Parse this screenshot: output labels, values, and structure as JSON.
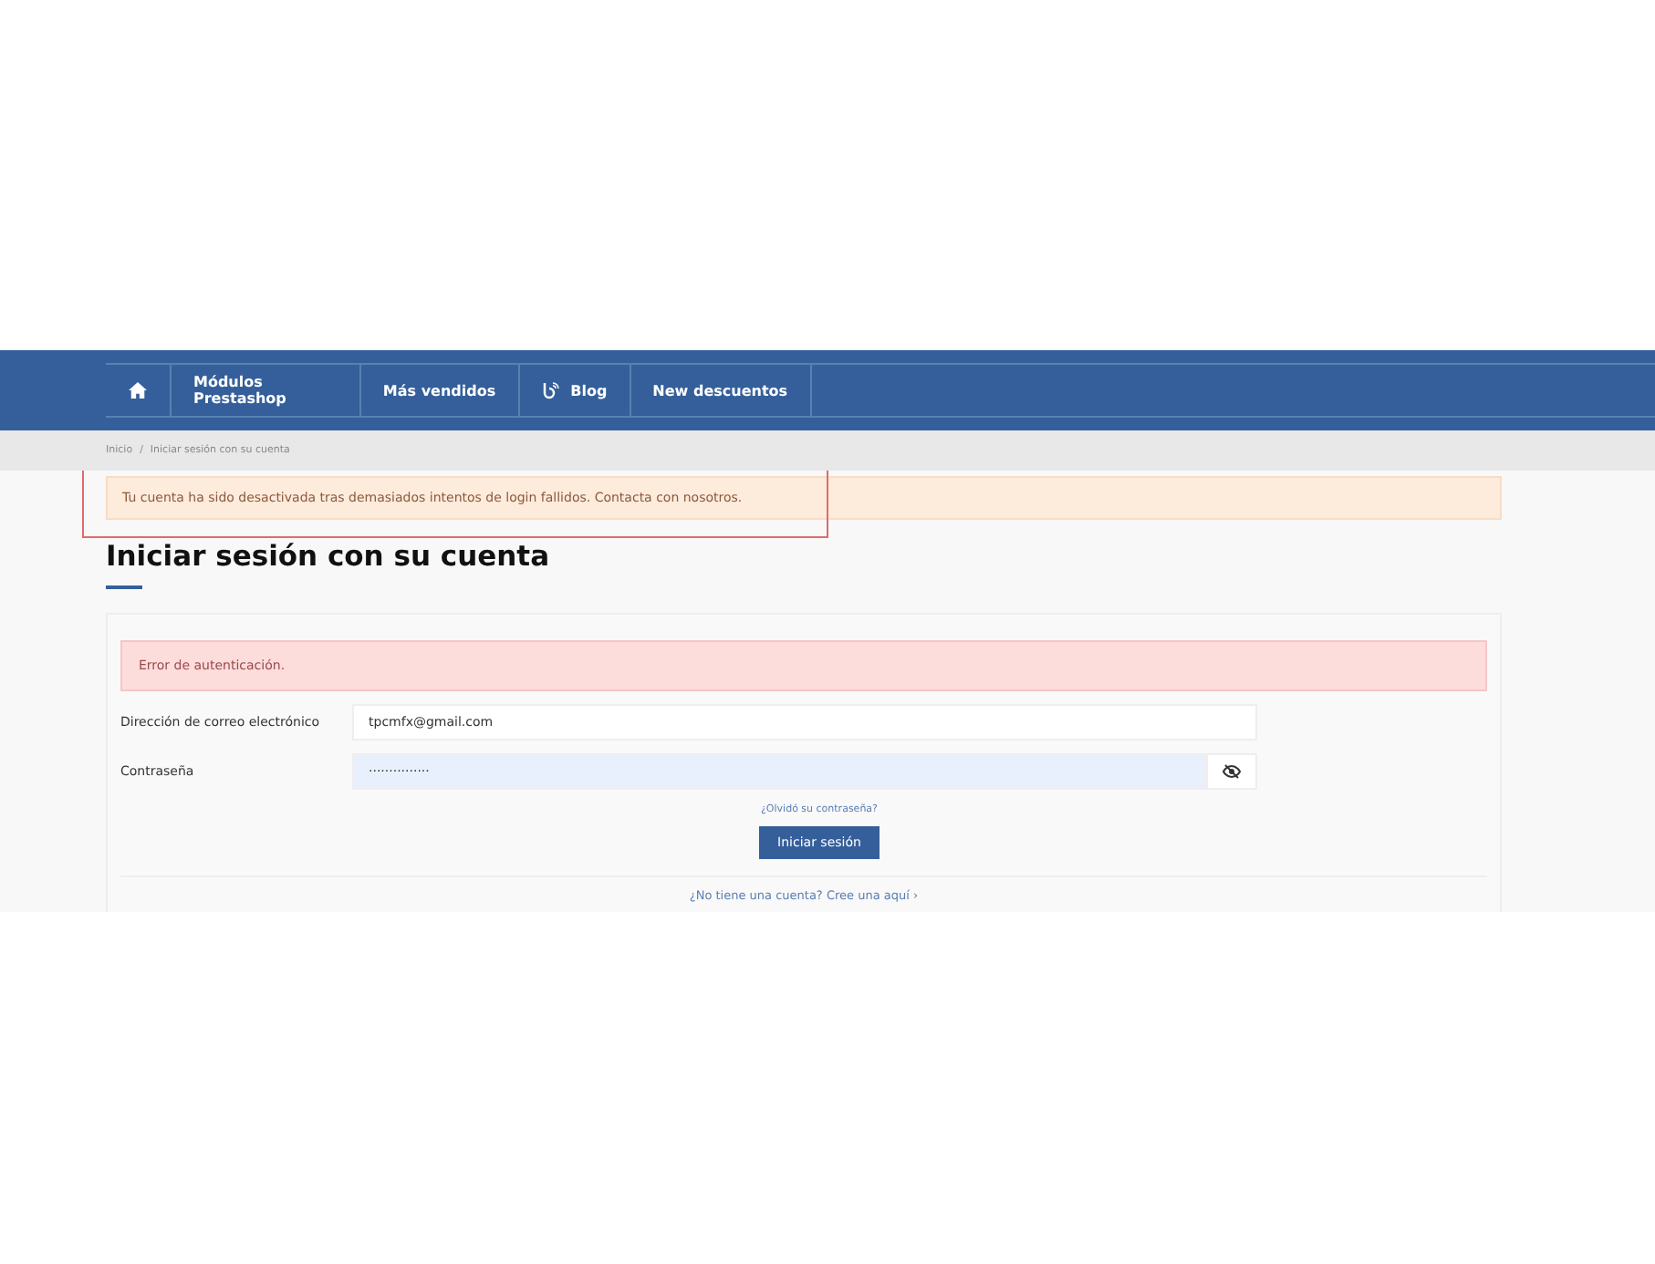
{
  "nav": {
    "items": [
      {
        "kind": "home"
      },
      {
        "kind": "text",
        "label": "Módulos\nPrestashop"
      },
      {
        "kind": "text",
        "label": "Más vendidos"
      },
      {
        "kind": "blog",
        "label": "Blog"
      },
      {
        "kind": "text",
        "label": "New descuentos"
      }
    ]
  },
  "breadcrumb": {
    "separator": "/",
    "items": [
      "Inicio",
      "Iniciar sesión con su cuenta"
    ]
  },
  "warning": {
    "text": "Tu cuenta ha sido desactivada tras demasiados intentos de login fallidos. Contacta con nosotros.",
    "highlighted": true
  },
  "title": "Iniciar sesión con su cuenta",
  "form": {
    "error": "Error de autenticación.",
    "fields": [
      {
        "kind": "email",
        "label": "Dirección de correo electrónico",
        "value": "tpcmfx@gmail.com",
        "autofilled": false
      },
      {
        "kind": "password",
        "label": "Contraseña",
        "value": "···············",
        "autofilled": true
      }
    ],
    "forgot_link": "¿Olvidó su contraseña?",
    "submit": "Iniciar sesión",
    "register_link": "¿No tiene una cuenta? Cree una aquí",
    "register_chevron": "›"
  }
}
